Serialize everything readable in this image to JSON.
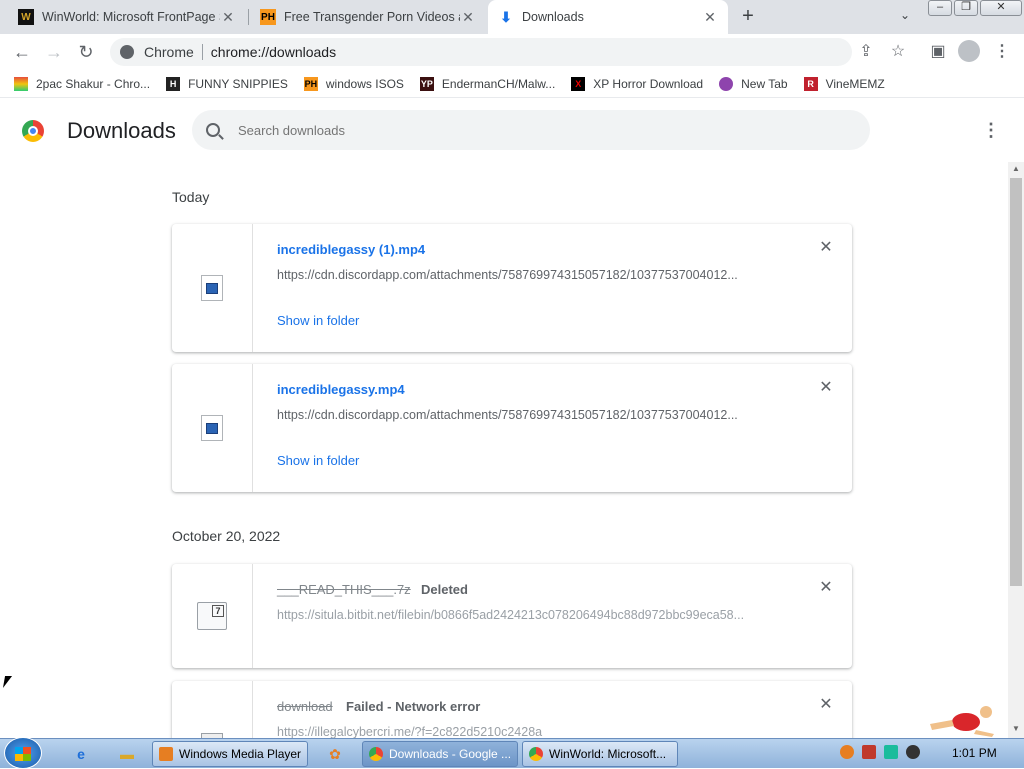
{
  "tabs": [
    {
      "title": "WinWorld: Microsoft FrontPage S",
      "icon": "winworld-icon",
      "active": false
    },
    {
      "title": "Free Transgender Porn Videos an",
      "icon": "ph-icon",
      "active": false
    },
    {
      "title": "Downloads",
      "icon": "download-icon",
      "active": true
    }
  ],
  "omnibox": {
    "chrome_label": "Chrome",
    "url": "chrome://downloads"
  },
  "bookmarks": [
    {
      "label": "2pac Shakur - Chro...",
      "icon": "chrome-rainbow-icon",
      "color": "#e8a33d"
    },
    {
      "label": "FUNNY SNIPPIES",
      "icon": "h-icon",
      "color": "#222222"
    },
    {
      "label": "windows ISOS",
      "icon": "ph-icon",
      "color": "#f7971d"
    },
    {
      "label": "EndermanCH/Malw...",
      "icon": "yp-icon",
      "color": "#3b1010"
    },
    {
      "label": "XP Horror Download",
      "icon": "x-icon",
      "color": "#b00000"
    },
    {
      "label": "New Tab",
      "icon": "chrome-icon",
      "color": "#c0392b"
    },
    {
      "label": "VineMEMZ",
      "icon": "r-icon",
      "color": "#c0212e"
    }
  ],
  "header": {
    "title": "Downloads",
    "search_placeholder": "Search downloads"
  },
  "groups": [
    {
      "date": "Today"
    },
    {
      "date": "October 20, 2022"
    }
  ],
  "downloads": [
    {
      "name": "incrediblegassy (1).mp4",
      "url": "https://cdn.discordapp.com/attachments/758769974315057182/10377537004012...",
      "action": "Show in folder",
      "status": ""
    },
    {
      "name": "incrediblegassy.mp4",
      "url": "https://cdn.discordapp.com/attachments/758769974315057182/10377537004012...",
      "action": "Show in folder",
      "status": ""
    },
    {
      "name": "___READ_THIS___.7z",
      "url": "https://situla.bitbit.net/filebin/b0866f5ad2424213c078206494bc88d972bbc99eca58...",
      "action": "",
      "status": "Deleted"
    },
    {
      "name": "download",
      "url": "https://illegalcybercri.me/?f=2c822d5210c2428a",
      "action": "",
      "status": "Failed - Network error"
    }
  ],
  "taskbar": {
    "tasks": [
      "Windows Media Player",
      "Downloads - Google ...",
      "WinWorld: Microsoft..."
    ],
    "clock": "1:01 PM"
  },
  "colors": {
    "link": "#1a73e8",
    "tab_strip": "#dee1e6"
  }
}
